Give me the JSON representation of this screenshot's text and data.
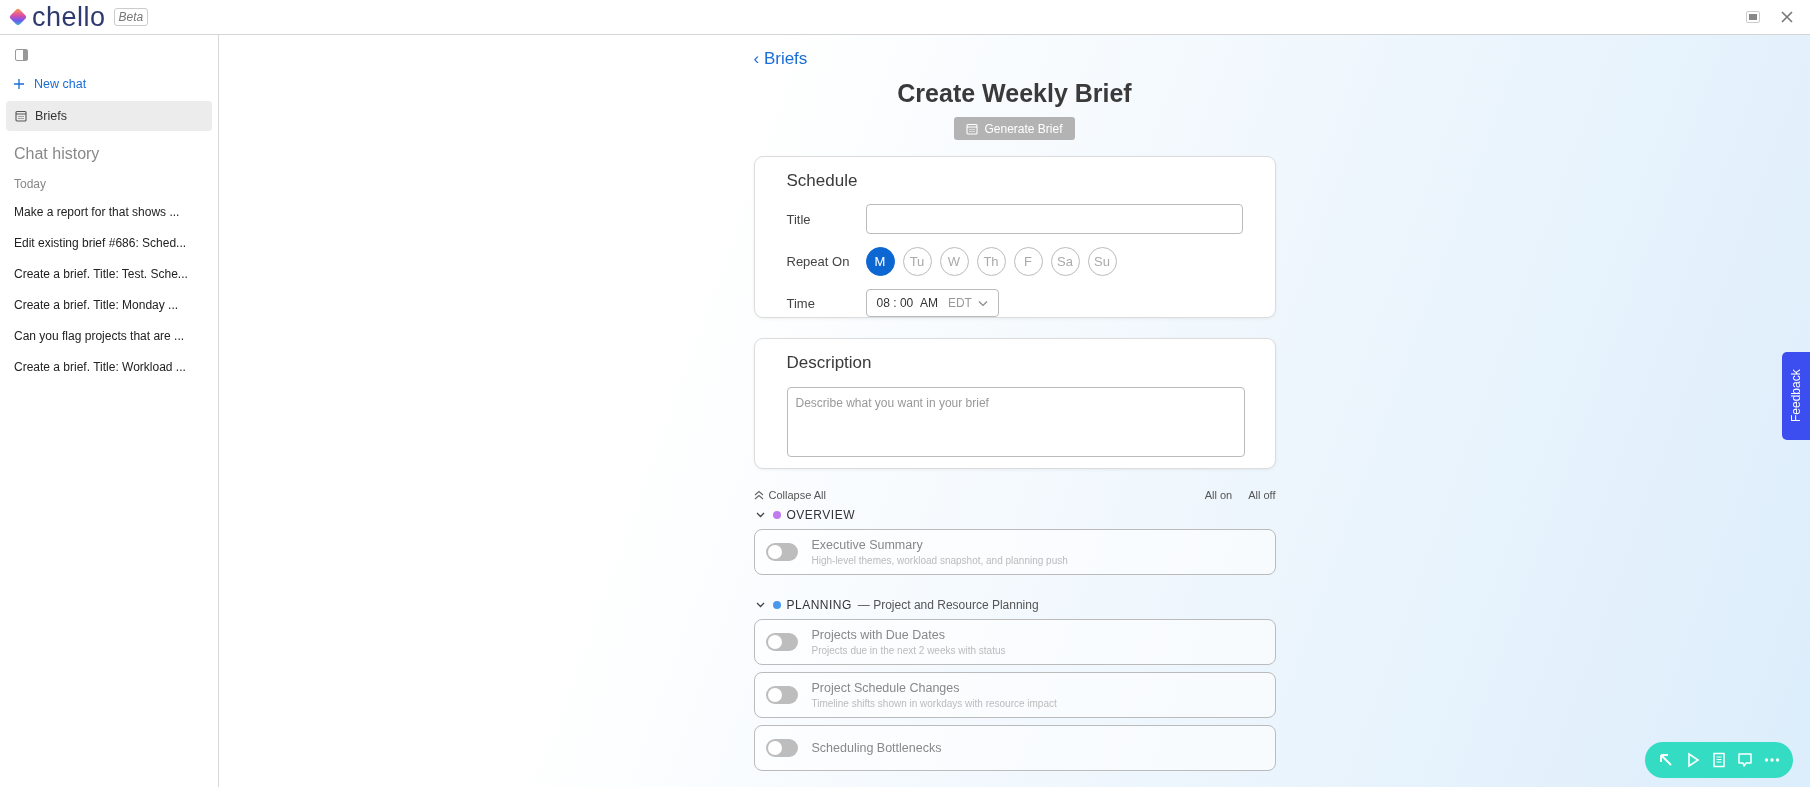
{
  "app": {
    "name": "chello",
    "badge": "Beta"
  },
  "sidebar": {
    "new_chat": "New chat",
    "nav": [
      {
        "label": "Briefs",
        "selected": true
      }
    ],
    "history_title": "Chat history",
    "groups": [
      {
        "label": "Today",
        "items": [
          "Make a report for that shows ...",
          "Edit existing brief #686: Sched...",
          "Create a brief. Title: Test. Sche...",
          "Create a brief. Title: Monday ...",
          "Can you flag projects that are ...",
          "Create a brief. Title: Workload ..."
        ]
      }
    ]
  },
  "main": {
    "back_link": "‹ Briefs",
    "title": "Create Weekly Brief",
    "generate_button": {
      "label": "Generate Brief",
      "disabled": true
    },
    "schedule": {
      "heading": "Schedule",
      "title_label": "Title",
      "repeat_label": "Repeat On",
      "days": [
        {
          "label": "M",
          "selected": true
        },
        {
          "label": "Tu",
          "selected": false
        },
        {
          "label": "W",
          "selected": false
        },
        {
          "label": "Th",
          "selected": false
        },
        {
          "label": "F",
          "selected": false
        },
        {
          "label": "Sa",
          "selected": false
        },
        {
          "label": "Su",
          "selected": false
        }
      ],
      "time_label": "Time",
      "time": {
        "hour": "08",
        "separator": ":",
        "minute": "00",
        "period": "AM",
        "zone": "EDT"
      }
    },
    "description": {
      "heading": "Description",
      "placeholder": "Describe what you want in your brief"
    },
    "controls": {
      "collapse_all": "Collapse All",
      "all_on": "All on",
      "all_off": "All off"
    },
    "sections": [
      {
        "name": "OVERVIEW",
        "color": "#c07af0",
        "expanded": true,
        "items": [
          {
            "title": "Executive Summary",
            "description": "High-level themes, workload snapshot, and planning push",
            "on": false
          }
        ]
      },
      {
        "name": "PLANNING",
        "subtitle": "— Project and Resource Planning",
        "color": "#4a97ee",
        "expanded": true,
        "items": [
          {
            "title": "Projects with Due Dates",
            "description": "Projects due in the next 2 weeks with status",
            "on": false
          },
          {
            "title": "Project Schedule Changes",
            "description": "Timeline shifts shown in workdays with resource impact",
            "on": false
          },
          {
            "title": "Scheduling Bottlenecks",
            "on": false
          }
        ]
      }
    ]
  },
  "feedback_tab": "Feedback"
}
